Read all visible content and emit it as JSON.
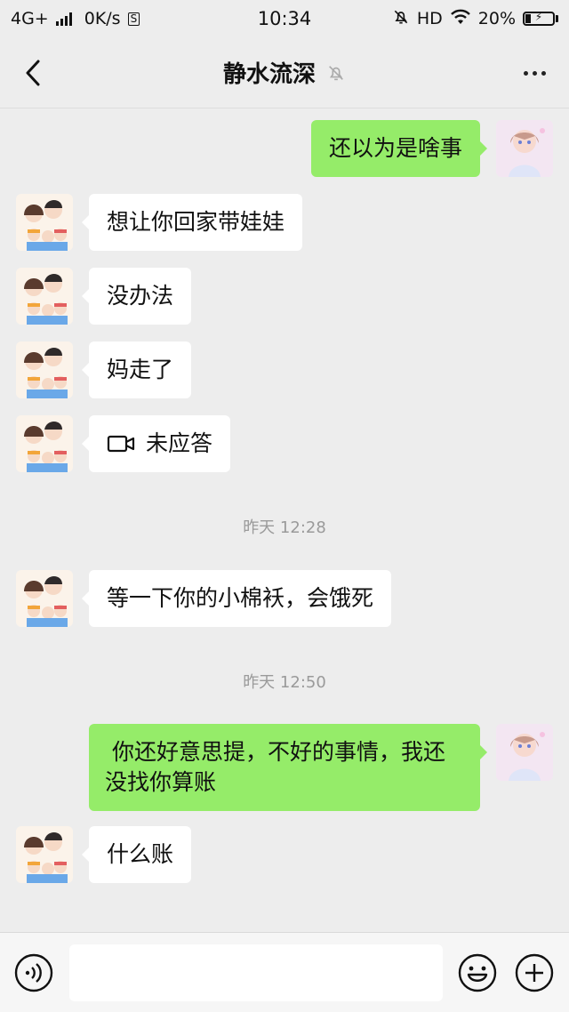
{
  "status_bar": {
    "network": "4G+",
    "speed": "0K/s",
    "time": "10:34",
    "hd": "HD",
    "battery_percent": "20%",
    "battery_level": 0.2
  },
  "header": {
    "title": "静水流深",
    "muted_icon": "bell-off-icon",
    "back_icon": "chevron-left-icon",
    "more_icon": "more-dots-icon"
  },
  "messages": [
    {
      "direction": "out",
      "text": "还以为是啥事"
    },
    {
      "direction": "in",
      "text": "想让你回家带娃娃"
    },
    {
      "direction": "in",
      "text": "没办法"
    },
    {
      "direction": "in",
      "text": "妈走了"
    },
    {
      "direction": "in",
      "text": "未应答",
      "icon": "video-call-icon"
    },
    {
      "timestamp": "昨天 12:28"
    },
    {
      "direction": "in",
      "text": "等一下你的小棉袄，会饿死"
    },
    {
      "timestamp": "昨天 12:50"
    },
    {
      "direction": "out",
      "text": " 你还好意思提，不好的事情，我还没找你算账"
    },
    {
      "direction": "in",
      "text": "什么账"
    }
  ],
  "input_bar": {
    "voice_icon": "voice-icon",
    "emoji_icon": "emoji-icon",
    "plus_icon": "plus-circle-icon",
    "input_value": ""
  },
  "colors": {
    "background": "#ededed",
    "outgoing_bubble": "#95ec69",
    "incoming_bubble": "#ffffff",
    "timestamp": "#9a9a9a"
  }
}
